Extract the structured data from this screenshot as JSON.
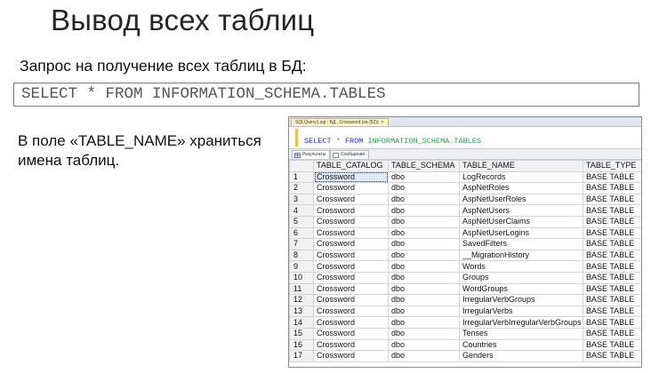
{
  "slide": {
    "title": "Вывод всех таблиц",
    "subtitle": "Запрос на получение всех таблиц в БД:",
    "query": "SELECT * FROM INFORMATION_SCHEMA.TABLES",
    "note": "В поле «TABLE_NAME» храниться имена таблиц."
  },
  "ssms": {
    "tab_title": "SQLQuery1.sql - БД...Crossword (sa (52))",
    "tab_close": "×",
    "editor": {
      "kw_select": "SELECT",
      "op_star": "*",
      "kw_from": "FROM",
      "object": "INFORMATION_SCHEMA.TABLES"
    },
    "result_tabs": [
      "Результаты",
      "Сообщения"
    ],
    "columns": [
      "TABLE_CATALOG",
      "TABLE_SCHEMA",
      "TABLE_NAME",
      "TABLE_TYPE"
    ],
    "rows": [
      [
        "1",
        "Crossword",
        "dbo",
        "LogRecords",
        "BASE TABLE"
      ],
      [
        "2",
        "Crossword",
        "dbo",
        "AspNetRoles",
        "BASE TABLE"
      ],
      [
        "3",
        "Crossword",
        "dbo",
        "AspNetUserRoles",
        "BASE TABLE"
      ],
      [
        "4",
        "Crossword",
        "dbo",
        "AspNetUsers",
        "BASE TABLE"
      ],
      [
        "5",
        "Crossword",
        "dbo",
        "AspNetUserClaims",
        "BASE TABLE"
      ],
      [
        "6",
        "Crossword",
        "dbo",
        "AspNetUserLogins",
        "BASE TABLE"
      ],
      [
        "7",
        "Crossword",
        "dbo",
        "SavedFilters",
        "BASE TABLE"
      ],
      [
        "8",
        "Crossword",
        "dbo",
        "__MigrationHistory",
        "BASE TABLE"
      ],
      [
        "9",
        "Crossword",
        "dbo",
        "Words",
        "BASE TABLE"
      ],
      [
        "10",
        "Crossword",
        "dbo",
        "Groups",
        "BASE TABLE"
      ],
      [
        "11",
        "Crossword",
        "dbo",
        "WordGroups",
        "BASE TABLE"
      ],
      [
        "12",
        "Crossword",
        "dbo",
        "IrregularVerbGroups",
        "BASE TABLE"
      ],
      [
        "13",
        "Crossword",
        "dbo",
        "IrregularVerbs",
        "BASE TABLE"
      ],
      [
        "14",
        "Crossword",
        "dbo",
        "IrregularVerbIrregularVerbGroups",
        "BASE TABLE"
      ],
      [
        "15",
        "Crossword",
        "dbo",
        "Tenses",
        "BASE TABLE"
      ],
      [
        "16",
        "Crossword",
        "dbo",
        "Countries",
        "BASE TABLE"
      ],
      [
        "17",
        "Crossword",
        "dbo",
        "Genders",
        "BASE TABLE"
      ]
    ]
  }
}
